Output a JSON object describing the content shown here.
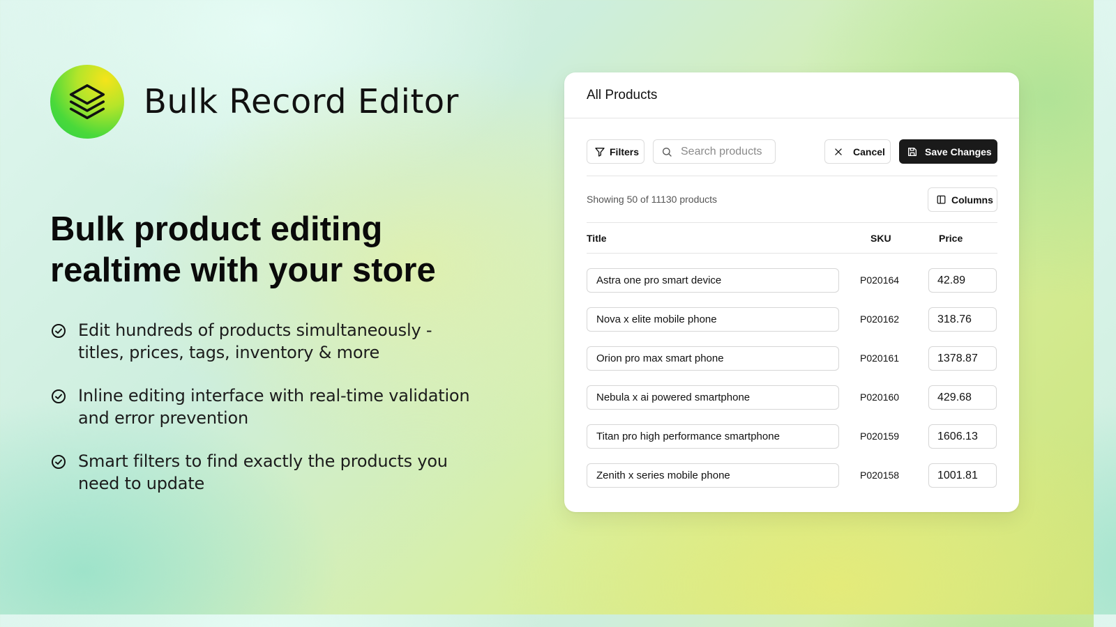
{
  "brand": {
    "name": "Bulk Record Editor",
    "logo_icon": "layers-icon",
    "logo_colors": [
      "#f5e41a",
      "#b4e52a",
      "#2fd14a"
    ]
  },
  "hero": {
    "headline": "Bulk product editing realtime with your store",
    "features": [
      {
        "icon": "check-circle-icon",
        "text": "Edit hundreds of products simultaneously - titles, prices, tags, inventory & more"
      },
      {
        "icon": "check-circle-icon",
        "text": "Inline editing interface with real-time validation and error prevention"
      },
      {
        "icon": "check-circle-icon",
        "text": "Smart filters to find exactly the products you need to update"
      }
    ]
  },
  "card": {
    "title": "All Products",
    "toolbar": {
      "filters_label": "Filters",
      "filters_icon": "filter-icon",
      "search_placeholder": "Search products",
      "search_value": "",
      "search_icon": "search-icon",
      "cancel_label": "Cancel",
      "cancel_icon": "close-icon",
      "save_label": "Save Changes",
      "save_icon": "save-icon",
      "save_bg": "#1a1a1a"
    },
    "summary": "Showing 50 of 11130 products",
    "columns_label": "Columns",
    "columns_icon": "columns-icon",
    "table": {
      "headers": {
        "title": "Title",
        "sku": "SKU",
        "price": "Price"
      },
      "rows": [
        {
          "title": "Astra one pro smart device",
          "sku": "P020164",
          "price": "42.89"
        },
        {
          "title": "Nova x elite mobile phone",
          "sku": "P020162",
          "price": "318.76"
        },
        {
          "title": "Orion pro max smart phone",
          "sku": "P020161",
          "price": "1378.87"
        },
        {
          "title": "Nebula x ai powered smartphone",
          "sku": "P020160",
          "price": "429.68"
        },
        {
          "title": "Titan pro high performance smartphone",
          "sku": "P020159",
          "price": "1606.13"
        },
        {
          "title": "Zenith x series mobile phone",
          "sku": "P020158",
          "price": "1001.81"
        }
      ]
    }
  }
}
